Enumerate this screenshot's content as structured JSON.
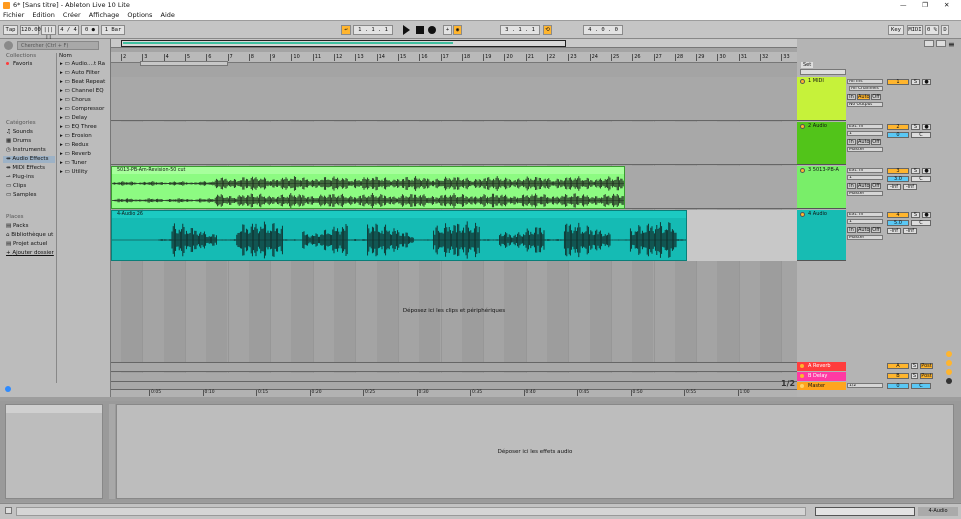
{
  "window": {
    "title": "6* [Sans titre] - Ableton Live 10 Lite"
  },
  "menu": [
    "Fichier",
    "Edition",
    "Créer",
    "Affichage",
    "Options",
    "Aide"
  ],
  "transport": {
    "tap": "Tap",
    "tempo": "120.00",
    "signature": "4 / 4",
    "metronome": "0 ●",
    "quantize": "1 Bar",
    "position": "1 .  1 .  1",
    "loop_start": "3 .  1 .  1",
    "loop_length": "4 .  0 .  0",
    "key_label": "Key",
    "midi_label": "MIDI",
    "cpu": "0 %",
    "d_label": "D"
  },
  "browser": {
    "search_placeholder": "Chercher (Ctrl + F)",
    "collections_title": "Collections",
    "favorites": "Favoris",
    "categories_title": "Catégories",
    "categories": [
      "Sounds",
      "Drums",
      "Instruments",
      "Audio Effects",
      "MIDI Effects",
      "Plug-ins",
      "Clips",
      "Samples"
    ],
    "places_title": "Places",
    "places": [
      "Packs",
      "Bibliothèque ut",
      "Projet actuel",
      "Ajouter dossier"
    ],
    "name_header": "Nom",
    "items": [
      "Audio....t Ra",
      "Auto Filter",
      "Beat Repeat",
      "Channel EQ",
      "Chorus",
      "Compressor",
      "Delay",
      "EQ Three",
      "Erosion",
      "Redux",
      "Reverb",
      "Tuner",
      "Utility"
    ]
  },
  "ruler": {
    "bars": [
      "2",
      "3",
      "4",
      "5",
      "6",
      "7",
      "8",
      "9",
      "10",
      "11",
      "12",
      "13",
      "14",
      "15",
      "16",
      "17",
      "18",
      "19",
      "20",
      "21",
      "22",
      "23",
      "24",
      "25",
      "26",
      "27",
      "28",
      "29",
      "30",
      "31",
      "32",
      "33"
    ],
    "time": [
      "0:05",
      "0:10",
      "0:15",
      "0:20",
      "0:25",
      "0:30",
      "0:35",
      "0:40",
      "0:45",
      "0:50",
      "0:55",
      "1:00"
    ]
  },
  "tracks": [
    {
      "name": "1 MIDI",
      "color": "#c6f23a",
      "input": "All Ins",
      "channel": "All Channels",
      "monitor": [
        "In",
        "Auto",
        "Off"
      ],
      "output": "No Output",
      "number": "1",
      "clip": ""
    },
    {
      "name": "2 Audio",
      "color": "#52c41a",
      "input": "Ext. In",
      "sub": "1",
      "monitor": [
        "In",
        "Auto",
        "Off"
      ],
      "output": "Master",
      "number": "2",
      "volume": "0",
      "pan": "C",
      "clip": ""
    },
    {
      "name": "3 5013-PB-A",
      "color": "#79ee69",
      "input": "Ext. In",
      "sub": "1",
      "monitor": [
        "In",
        "Auto",
        "Off"
      ],
      "output": "Master",
      "number": "3",
      "volume": "3.0",
      "pan": "C",
      "inf1": "-inf",
      "inf2": "-inf",
      "clip": "5013-PB-Am-Revision-50 cut"
    },
    {
      "name": "4 Audio",
      "color": "#17bcb3",
      "input": "Ext. In",
      "sub": "1",
      "monitor": [
        "In",
        "Auto",
        "Off"
      ],
      "output": "Master",
      "number": "4",
      "volume": "5.0",
      "pan": "C",
      "inf1": "-inf",
      "inf2": "-inf",
      "clip": "4-Audio 26"
    }
  ],
  "drop_clips": "Déposez ici les clips et périphériques",
  "returns": [
    {
      "name": "A Reverb",
      "color": "#ff3d3d",
      "letter": "A",
      "post": "Post"
    },
    {
      "name": "B Delay",
      "color": "#ff3aa3",
      "letter": "B",
      "post": "Post"
    }
  ],
  "master": {
    "name": "Master",
    "color": "#ffa51e",
    "cue": "1/2",
    "number": "0",
    "pan": "C"
  },
  "page_indicator": "1/2",
  "set_label": "Set",
  "detail": {
    "drop_effects": "Déposer ici les effets audio"
  },
  "status": {
    "track": "4-Audio"
  },
  "colors": {
    "accent": "#ffb52e",
    "loop": "#2e8bff"
  }
}
